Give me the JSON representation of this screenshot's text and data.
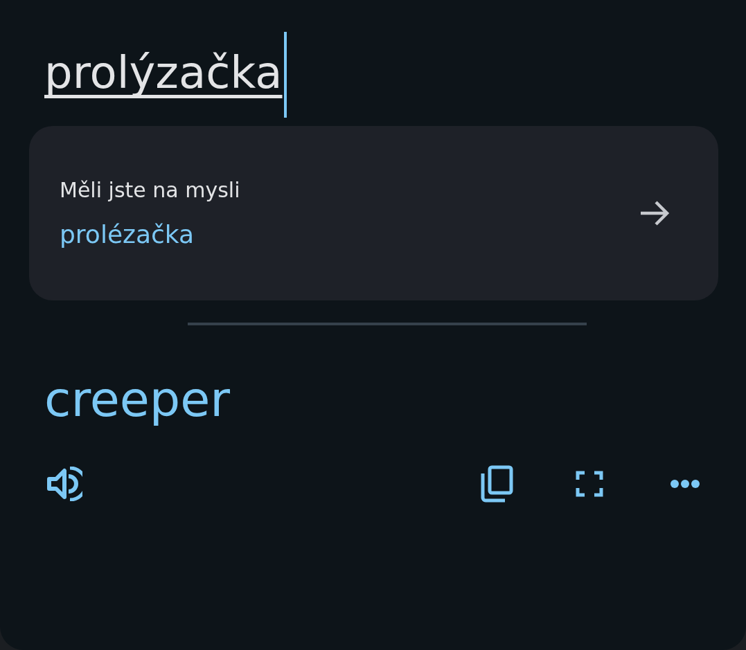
{
  "source_input": {
    "value": "prolýzačka",
    "focused": true
  },
  "suggestion": {
    "label": "Měli jste na mysli",
    "text": "prolézačka"
  },
  "translation": {
    "text": "creeper"
  },
  "actions": [
    {
      "kind": "speak"
    },
    {
      "kind": "copy"
    },
    {
      "kind": "fullscreen"
    },
    {
      "kind": "more"
    }
  ]
}
